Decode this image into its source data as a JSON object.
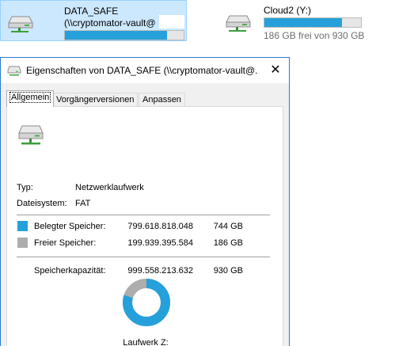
{
  "explorer": {
    "drive1": {
      "name": "DATA_SAFE",
      "subtitle": "(\\\\cryptomator-vault@",
      "used_fraction": 0.86
    },
    "drive2": {
      "name": "Cloud2 (Y:)",
      "free_text": "186 GB frei von 930 GB",
      "used_fraction": 0.8
    }
  },
  "window": {
    "title": "Eigenschaften von DATA_SAFE (\\\\cryptomator-vault@...",
    "close_glyph": "✕",
    "tabs": [
      "Allgemein",
      "Vorgängerversionen",
      "Anpassen"
    ]
  },
  "general": {
    "type_label": "Typ:",
    "type_value": "Netzwerklaufwerk",
    "fs_label": "Dateisystem:",
    "fs_value": "FAT",
    "used_label": "Belegter Speicher:",
    "used_bytes": "799.618.818.048",
    "used_gb": "744 GB",
    "free_label": "Freier Speicher:",
    "free_bytes": "199.939.395.584",
    "free_gb": "186 GB",
    "capacity_label": "Speicherkapazität:",
    "capacity_bytes": "999.558.213.632",
    "capacity_gb": "930 GB",
    "drive_label": "Laufwerk Z:",
    "used_fraction": 0.8
  },
  "colors": {
    "used": "#26a0da",
    "free": "#adadad",
    "accent": "#2b79d0"
  }
}
